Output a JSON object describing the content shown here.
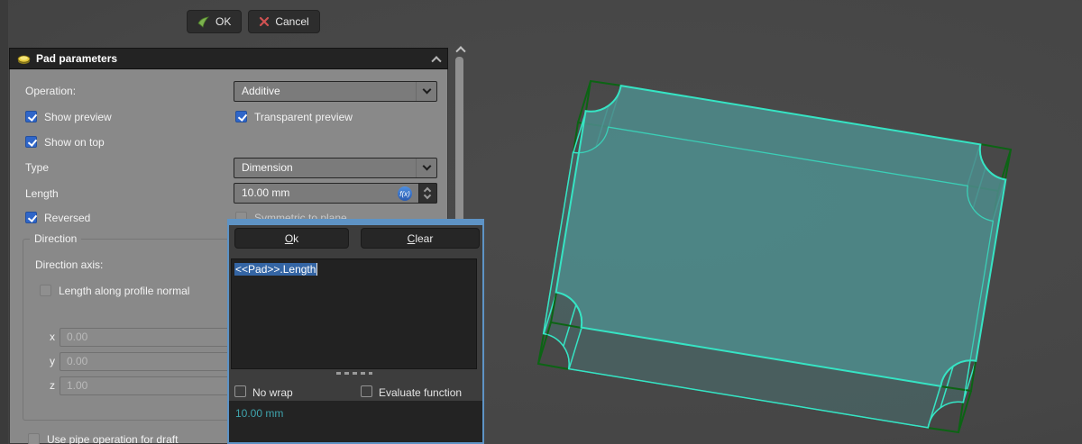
{
  "toolbar": {
    "ok_label": "OK",
    "cancel_label": "Cancel"
  },
  "panel": {
    "header": {
      "title": "Pad parameters"
    },
    "operation_label": "Operation:",
    "operation_value": "Additive",
    "show_preview_label": "Show preview",
    "transparent_preview_label": "Transparent preview",
    "show_on_top_label": "Show on top",
    "type_label": "Type",
    "type_value": "Dimension",
    "length_label": "Length",
    "length_value": "10.00 mm",
    "fx_icon_text": "f(x)",
    "reversed_label": "Reversed",
    "symmetric_label": "Symmetric to plane",
    "direction": {
      "group_label": "Direction",
      "axis_label": "Direction axis:",
      "profile_normal_label": "Length along profile normal",
      "x_label": "x",
      "x_value": "0.00",
      "y_label": "y",
      "y_value": "0.00",
      "z_label": "z",
      "z_value": "1.00"
    },
    "use_pipe_label": "Use pipe operation for draft"
  },
  "popup": {
    "ok_first": "O",
    "ok_rest": "k",
    "clear_first": "C",
    "clear_rest": "lear",
    "expression": "<<Pad>>.Length",
    "no_wrap_label": "No wrap",
    "evaluate_label": "Evaluate function",
    "result_value": "10.00 mm"
  },
  "colors": {
    "accent_blue": "#2f66c9",
    "popup_border": "#5e93c5",
    "selection_blue": "#3465a4",
    "model_face": "#4d8a8a",
    "model_edge": "#36e4c4",
    "sketch_edge": "#0c6414",
    "result_teal": "#3fa4ad",
    "ok_icon_green": "#7cb24e",
    "cancel_icon_red": "#d05252",
    "pad_icon_yellow": "#e6c93c"
  }
}
